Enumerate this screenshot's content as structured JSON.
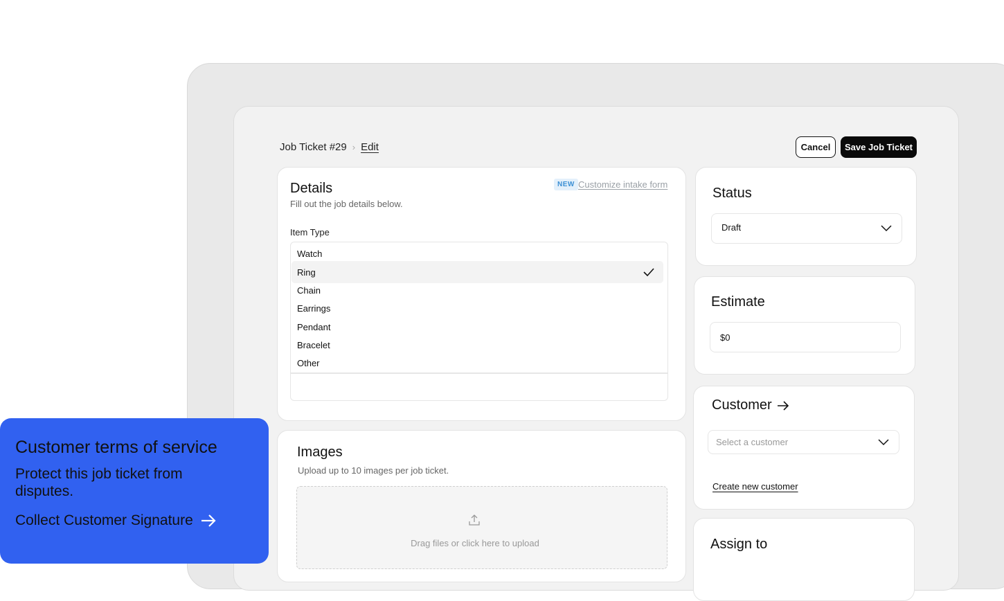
{
  "header": {
    "breadcrumb_parent": "Job Ticket #29",
    "breadcrumb_current": "Edit",
    "cancel_label": "Cancel",
    "save_label": "Save Job Ticket"
  },
  "details": {
    "title": "Details",
    "subtitle": "Fill out the job details below.",
    "badge": "NEW",
    "customize_link": "Customize intake form",
    "item_type_label": "Item Type",
    "options": [
      "Watch",
      "Ring",
      "Chain",
      "Earrings",
      "Pendant",
      "Bracelet",
      "Other"
    ],
    "selected_option": "Ring"
  },
  "images": {
    "title": "Images",
    "subtitle": "Upload up to 10 images per job ticket.",
    "dropzone_text": "Drag files or click here to upload"
  },
  "status": {
    "title": "Status",
    "value": "Draft"
  },
  "estimate": {
    "title": "Estimate",
    "value": "$0"
  },
  "customer": {
    "title": "Customer",
    "placeholder": "Select a customer",
    "create_link": "Create new customer"
  },
  "assign": {
    "title": "Assign to"
  },
  "promo": {
    "title": "Customer terms of service",
    "subtitle": "Protect this job ticket from disputes.",
    "cta": "Collect Customer Signature"
  },
  "colors": {
    "promo_bg": "#3161f0",
    "badge_text": "#3b8fd4",
    "primary_button": "#0a0a0a"
  }
}
